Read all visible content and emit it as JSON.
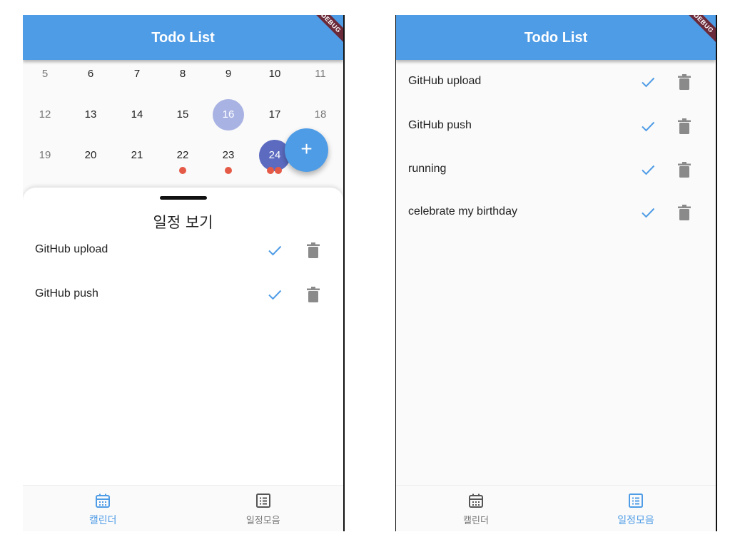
{
  "app": {
    "title": "Todo List",
    "debug_label": "DEBUG"
  },
  "colors": {
    "primary": "#4f9ce6",
    "today": "#a9b3e3",
    "selected": "#5c6bc0",
    "marker": "#e55a46",
    "icon_gray": "#8a8a8a"
  },
  "calendar": {
    "rows": [
      [
        "5",
        "6",
        "7",
        "8",
        "9",
        "10",
        "11"
      ],
      [
        "12",
        "13",
        "14",
        "15",
        "16",
        "17",
        "18"
      ],
      [
        "19",
        "20",
        "21",
        "22",
        "23",
        "24",
        ""
      ]
    ],
    "today": "16",
    "selected": "24",
    "event_counts": {
      "22": 1,
      "23": 1,
      "24": 2
    },
    "fab_label": "+"
  },
  "sheet": {
    "title": "일정 보기",
    "todos": [
      {
        "label": "GitHub upload",
        "done_icon": "check-icon",
        "delete_icon": "trash-icon"
      },
      {
        "label": "GitHub push",
        "done_icon": "check-icon",
        "delete_icon": "trash-icon"
      }
    ]
  },
  "all_todos": [
    {
      "label": "GitHub upload"
    },
    {
      "label": "GitHub push"
    },
    {
      "label": "running"
    },
    {
      "label": "celebrate my birthday"
    }
  ],
  "nav": {
    "calendar_label": "캘린더",
    "schedule_label": "일정모음",
    "calendar_icon": "calendar-icon",
    "schedule_icon": "list-icon"
  }
}
